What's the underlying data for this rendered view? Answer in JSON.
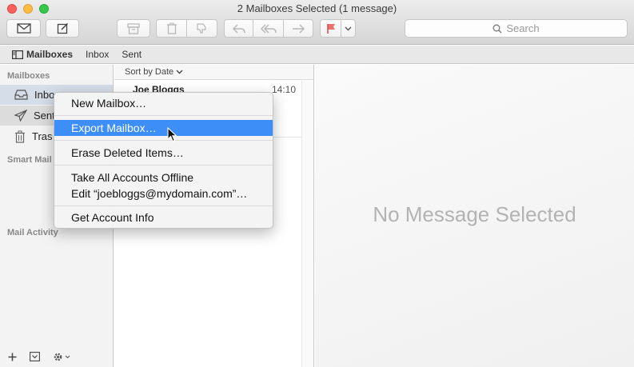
{
  "window": {
    "title": "2 Mailboxes Selected (1 message)"
  },
  "toolbar": {
    "compose_icon": "envelope-icon",
    "new_message_icon": "compose-icon",
    "search_placeholder": "Search"
  },
  "favorites": {
    "items": [
      "Mailboxes",
      "Inbox",
      "Sent"
    ]
  },
  "sidebar": {
    "mailboxes_header": "Mailboxes",
    "items": [
      {
        "label": "Inbo",
        "icon": "inbox-icon"
      },
      {
        "label": "Sent",
        "icon": "paper-plane-icon"
      },
      {
        "label": "Tras",
        "icon": "trash-icon"
      }
    ],
    "smart_header": "Smart Mail",
    "activity_header": "Mail Activity"
  },
  "message_list": {
    "sort_label": "Sort by Date",
    "messages": [
      {
        "from": "Joe Bloggs",
        "time": "14:10"
      }
    ]
  },
  "detail": {
    "empty_text": "No Message Selected"
  },
  "context_menu": {
    "items": [
      "New Mailbox…",
      "Export Mailbox…",
      "Erase Deleted Items…",
      "Take All Accounts Offline",
      "Edit “joebloggs@mydomain.com”…",
      "Get Account Info"
    ],
    "highlighted": "Export Mailbox…"
  },
  "colors": {
    "highlight": "#3d8ef7",
    "flag": "#e8473f"
  }
}
